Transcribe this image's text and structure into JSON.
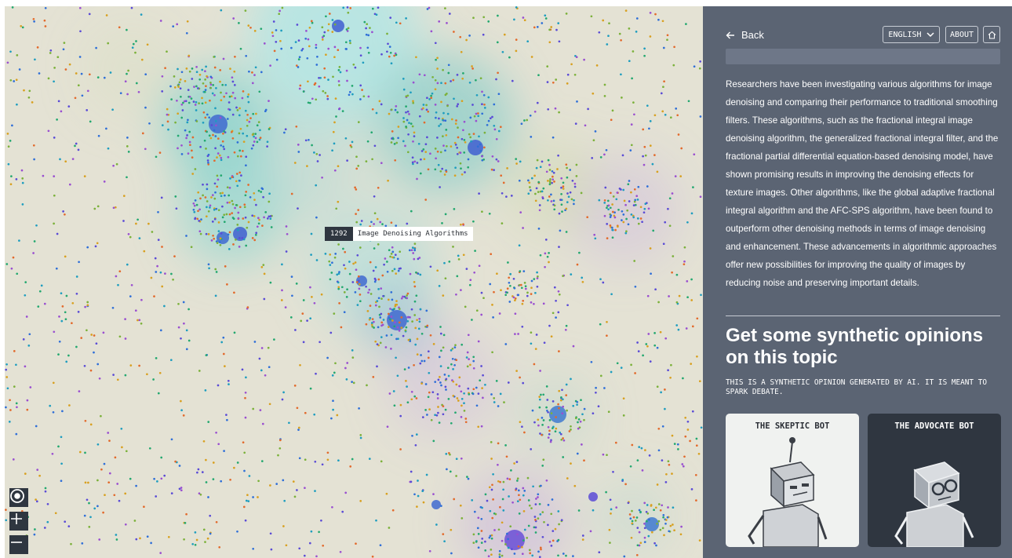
{
  "map": {
    "tooltip": {
      "count": "1292",
      "label": "Image Denoising Algorithms"
    },
    "controls": {
      "locate_icon": "target-icon",
      "zoom_in_icon": "plus-icon",
      "zoom_out_icon": "minus-icon"
    }
  },
  "panel": {
    "back_label": "Back",
    "back_icon": "arrow-left-icon",
    "language_select": {
      "selected": "ENGLISH"
    },
    "about_label": "ABOUT",
    "home_icon": "home-icon",
    "summary": "Researchers have been investigating various algorithms for image denoising and comparing their performance to traditional smoothing filters. These algorithms, such as the fractional integral image denoising algorithm, the generalized fractional integral filter, and the fractional partial differential equation-based denoising model, have shown promising results in improving the denoising effects for texture images. Other algorithms, like the global adaptive fractional integral algorithm and the AFC-SPS algorithm, have been found to outperform other denoising methods in terms of image denoising and enhancement. These advancements in algorithmic approaches offer new possibilities for improving the quality of images by reducing noise and preserving important details.",
    "opinions_heading": "Get some synthetic opinions on this topic",
    "disclaimer": "THIS IS A SYNTHETIC OPINION GENERATED BY AI. IT IS MEANT TO SPARK DEBATE.",
    "bots": [
      {
        "name": "THE SKEPTIC BOT",
        "bg": "#f0f2f0",
        "fg": "#2b2f36"
      },
      {
        "name": "THE ADVOCATE BOT",
        "bg": "#2f3640",
        "fg": "#ffffff"
      }
    ]
  },
  "colors": {
    "map_background": "#e4e2d4",
    "panel_background": "#5b6473",
    "dark_control": "#2f3640",
    "dot_palette": [
      "#5a4bd6",
      "#2f6fd8",
      "#1e9dbf",
      "#23a86f",
      "#7bb13a",
      "#d8a020",
      "#e26a2c",
      "#9a4fd0"
    ]
  }
}
